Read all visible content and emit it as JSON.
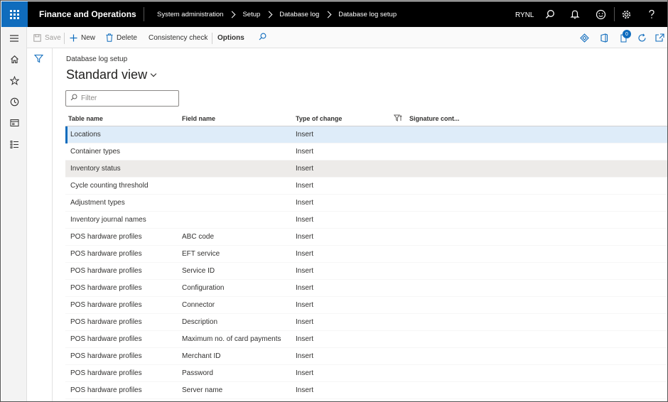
{
  "app": {
    "title": "Finance and Operations"
  },
  "breadcrumb": [
    "System administration",
    "Setup",
    "Database log",
    "Database log setup"
  ],
  "header": {
    "company": "RYNL",
    "icons": [
      "search-icon",
      "bell-icon",
      "smiley-icon",
      "gear-icon",
      "help-icon"
    ]
  },
  "leftnav": {
    "items": [
      "hamburger-icon",
      "home-icon",
      "star-icon",
      "clock-icon",
      "workspace-icon",
      "modules-icon"
    ]
  },
  "actions": {
    "save": "Save",
    "new": "New",
    "delete": "Delete",
    "consistency_check": "Consistency check",
    "options": "Options",
    "badge_count": "0"
  },
  "page": {
    "caption": "Database log setup",
    "view": "Standard view",
    "filter_placeholder": "Filter"
  },
  "grid": {
    "columns": [
      "Table name",
      "Field name",
      "Type of change",
      "Signature cont..."
    ],
    "rows": [
      {
        "table": "Locations",
        "field": "",
        "type": "Insert"
      },
      {
        "table": "Container types",
        "field": "",
        "type": "Insert"
      },
      {
        "table": "Inventory status",
        "field": "",
        "type": "Insert"
      },
      {
        "table": "Cycle counting threshold",
        "field": "",
        "type": "Insert"
      },
      {
        "table": "Adjustment types",
        "field": "",
        "type": "Insert"
      },
      {
        "table": "Inventory journal names",
        "field": "",
        "type": "Insert"
      },
      {
        "table": "POS hardware profiles",
        "field": "ABC code",
        "type": "Insert"
      },
      {
        "table": "POS hardware profiles",
        "field": "EFT service",
        "type": "Insert"
      },
      {
        "table": "POS hardware profiles",
        "field": "Service ID",
        "type": "Insert"
      },
      {
        "table": "POS hardware profiles",
        "field": "Configuration",
        "type": "Insert"
      },
      {
        "table": "POS hardware profiles",
        "field": "Connector",
        "type": "Insert"
      },
      {
        "table": "POS hardware profiles",
        "field": "Description",
        "type": "Insert"
      },
      {
        "table": "POS hardware profiles",
        "field": "Maximum no. of card payments",
        "type": "Insert"
      },
      {
        "table": "POS hardware profiles",
        "field": "Merchant ID",
        "type": "Insert"
      },
      {
        "table": "POS hardware profiles",
        "field": "Password",
        "type": "Insert"
      },
      {
        "table": "POS hardware profiles",
        "field": "Server name",
        "type": "Insert"
      }
    ]
  },
  "colors": {
    "accent": "#0f6cbd",
    "topbar": "#000000",
    "selected_row": "#deecf9",
    "hover_row": "#edebe9"
  }
}
